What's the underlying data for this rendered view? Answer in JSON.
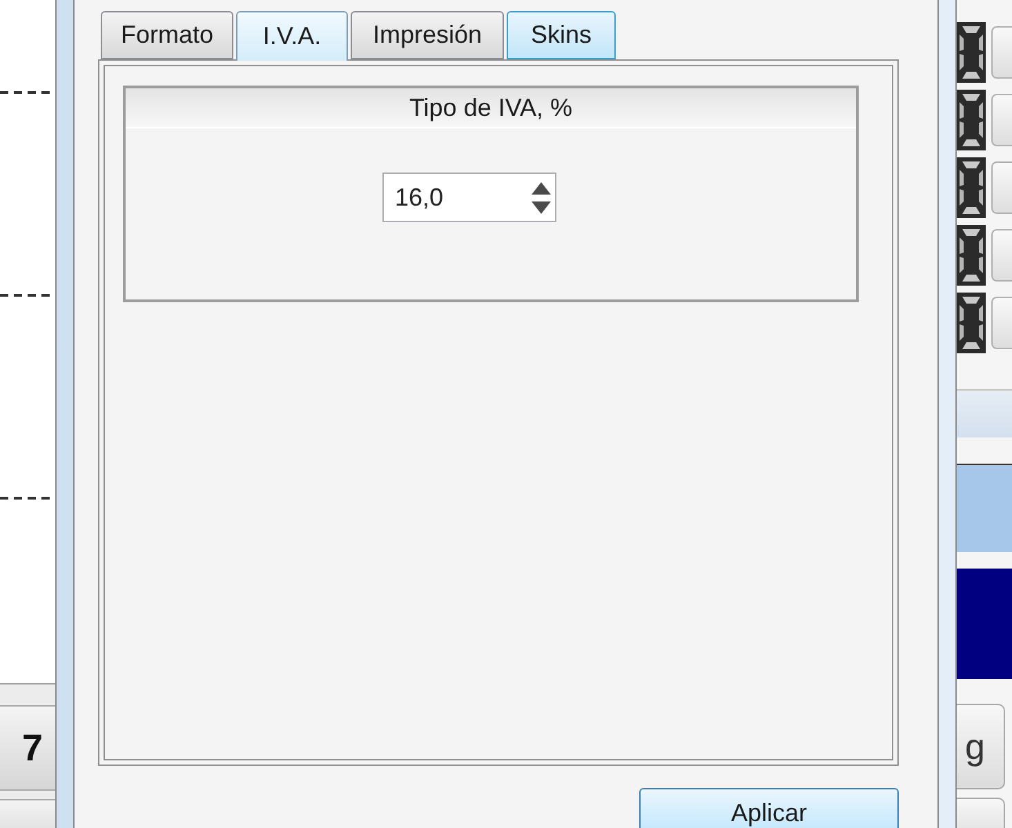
{
  "dialog": {
    "tabs": [
      {
        "label": "Formato",
        "selected": false,
        "hover": false
      },
      {
        "label": "I.V.A.",
        "selected": true,
        "hover": false
      },
      {
        "label": "Impresión",
        "selected": false,
        "hover": false
      },
      {
        "label": "Skins",
        "selected": false,
        "hover": true
      }
    ],
    "vat_group": {
      "title": "Tipo de IVA, %",
      "value": "16,0"
    },
    "apply_button": {
      "label": "Aplicar"
    }
  },
  "left_panel": {
    "buttons": [
      {
        "label": "7"
      }
    ]
  },
  "right_panel": {
    "buttons": [
      {
        "label": "g"
      }
    ]
  }
}
